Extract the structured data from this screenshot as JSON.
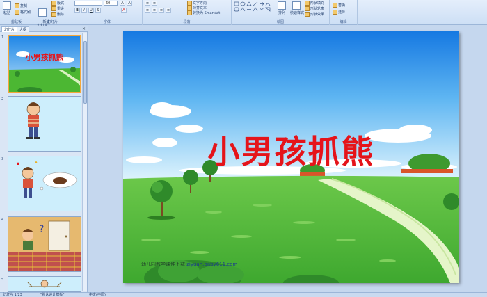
{
  "ribbon": {
    "groups": {
      "clipboard": "剪贴板",
      "slides": "幻灯片",
      "font": "字体",
      "paragraph": "段落",
      "drawing": "绘图",
      "editing": "编辑"
    },
    "paste": "粘贴",
    "copy": "复制",
    "format_painter": "格式刷",
    "new_slide": "新建\n幻灯片",
    "layout": "版式",
    "reset": "重设",
    "delete": "删除",
    "font_size": "60",
    "text_direction": "文字方向",
    "align_text": "对齐文本",
    "convert_smartart": "转换为 SmartArt",
    "arrange": "排列",
    "quick_styles": "快速样式",
    "shape_fill": "形状填充",
    "shape_outline": "形状轮廓",
    "shape_effects": "形状效果",
    "replace": "替换",
    "select": "选择"
  },
  "left_panel": {
    "tabs": [
      "幻灯片",
      "大纲"
    ],
    "close": "×",
    "slide_numbers": [
      "1",
      "2",
      "3",
      "4",
      "5"
    ],
    "slide1_title": "小男孩抓熊"
  },
  "slide": {
    "title": "小男孩抓熊",
    "footer_text": "幼儿园教学课件下载",
    "footer_url": "ziyuan.baby611.com"
  },
  "statusbar": {
    "slide_info": "幻灯片 1/23",
    "theme": "\"默认设计模板\"",
    "language": "中文(中国)"
  },
  "colors": {
    "sky_top": "#1f86e6",
    "grass": "#4cb733",
    "title_red": "#e5141a",
    "selection": "#f3a73b"
  }
}
